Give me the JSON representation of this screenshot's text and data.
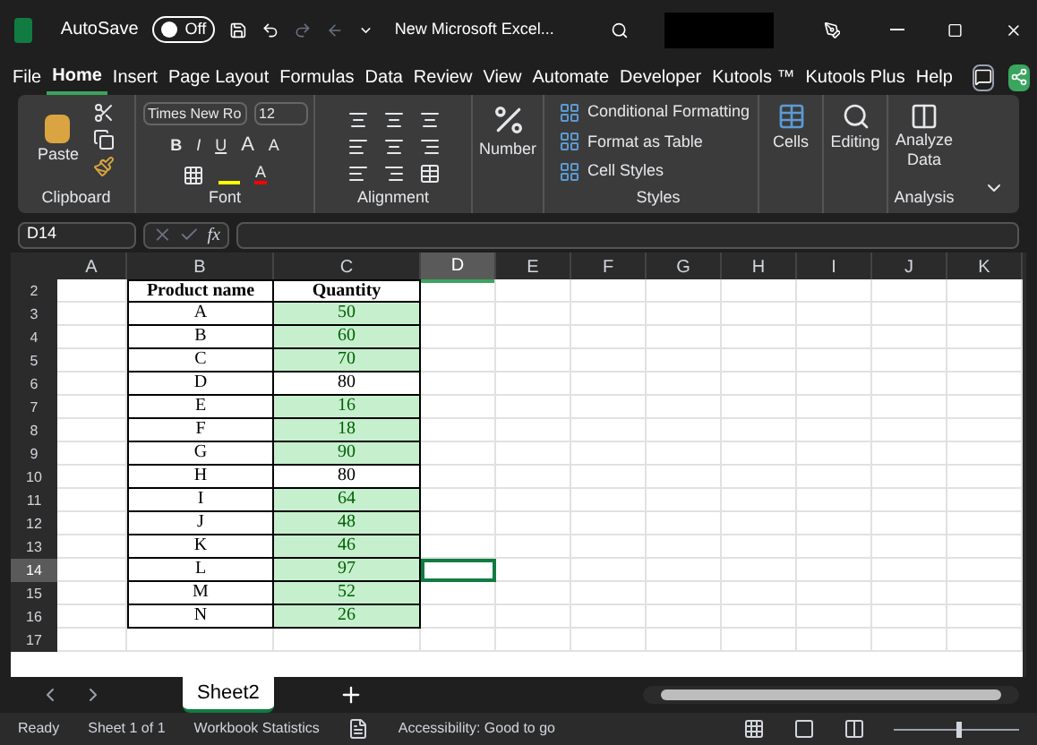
{
  "title_bar": {
    "autosave_label": "AutoSave",
    "autosave_state": "Off",
    "autosave_on": false,
    "file_name": "New Microsoft Excel..."
  },
  "menu_tabs": [
    {
      "label": "File",
      "selected": false
    },
    {
      "label": "Home",
      "selected": true
    },
    {
      "label": "Insert",
      "selected": false
    },
    {
      "label": "Page Layout",
      "selected": false
    },
    {
      "label": "Formulas",
      "selected": false
    },
    {
      "label": "Data",
      "selected": false
    },
    {
      "label": "Review",
      "selected": false
    },
    {
      "label": "View",
      "selected": false
    },
    {
      "label": "Automate",
      "selected": false
    },
    {
      "label": "Developer",
      "selected": false
    },
    {
      "label": "Kutools ™",
      "selected": false
    },
    {
      "label": "Kutools Plus",
      "selected": false
    },
    {
      "label": "Help",
      "selected": false
    }
  ],
  "ribbon": {
    "clipboard": {
      "label": "Clipboard",
      "paste": "Paste"
    },
    "font": {
      "label": "Font",
      "font_name": "Times New Ro",
      "font_size": "12",
      "bold": "B",
      "italic": "I",
      "underline": "U",
      "grow": "A",
      "shrink": "A",
      "font_color_button": "A"
    },
    "alignment": {
      "label": "Alignment"
    },
    "number": {
      "label": "Number"
    },
    "styles": {
      "label": "Styles",
      "items": [
        "Conditional Formatting",
        "Format as Table",
        "Cell Styles"
      ]
    },
    "cells": {
      "label": "Cells"
    },
    "editing": {
      "label": "Editing"
    },
    "analysis": {
      "label": "Analysis",
      "button": "Analyze Data"
    }
  },
  "formula_bar": {
    "name_box": "D14",
    "fx": "fx"
  },
  "grid": {
    "columns": [
      {
        "label": "A",
        "selected": false
      },
      {
        "label": "B",
        "selected": false
      },
      {
        "label": "C",
        "selected": false
      },
      {
        "label": "D",
        "selected": true
      },
      {
        "label": "E",
        "selected": false
      },
      {
        "label": "F",
        "selected": false
      },
      {
        "label": "G",
        "selected": false
      },
      {
        "label": "H",
        "selected": false
      },
      {
        "label": "I",
        "selected": false
      },
      {
        "label": "J",
        "selected": false
      },
      {
        "label": "K",
        "selected": false
      }
    ],
    "header_row": {
      "number": "2",
      "product": "Product name",
      "quantity": "Quantity"
    },
    "rows": [
      {
        "number": "3",
        "product": "A",
        "quantity": "50",
        "highlighted": true,
        "selected": false
      },
      {
        "number": "4",
        "product": "B",
        "quantity": "60",
        "highlighted": true,
        "selected": false
      },
      {
        "number": "5",
        "product": "C",
        "quantity": "70",
        "highlighted": true,
        "selected": false
      },
      {
        "number": "6",
        "product": "D",
        "quantity": "80",
        "highlighted": false,
        "selected": false
      },
      {
        "number": "7",
        "product": "E",
        "quantity": "16",
        "highlighted": true,
        "selected": false
      },
      {
        "number": "8",
        "product": "F",
        "quantity": "18",
        "highlighted": true,
        "selected": false
      },
      {
        "number": "9",
        "product": "G",
        "quantity": "90",
        "highlighted": true,
        "selected": false
      },
      {
        "number": "10",
        "product": "H",
        "quantity": "80",
        "highlighted": false,
        "selected": false
      },
      {
        "number": "11",
        "product": "I",
        "quantity": "64",
        "highlighted": true,
        "selected": false
      },
      {
        "number": "12",
        "product": "J",
        "quantity": "48",
        "highlighted": true,
        "selected": false
      },
      {
        "number": "13",
        "product": "K",
        "quantity": "46",
        "highlighted": true,
        "selected": false
      },
      {
        "number": "14",
        "product": "L",
        "quantity": "97",
        "highlighted": true,
        "selected": true
      },
      {
        "number": "15",
        "product": "M",
        "quantity": "52",
        "highlighted": true,
        "selected": false
      },
      {
        "number": "16",
        "product": "N",
        "quantity": "26",
        "highlighted": true,
        "selected": false
      }
    ],
    "empty_rows": [
      "17"
    ]
  },
  "sheet_tabs": [
    {
      "label": "Sheet2",
      "selected": true
    }
  ],
  "status_bar": {
    "items": [
      "Ready",
      "Sheet 1 of 1",
      "Workbook Statistics"
    ],
    "accessibility": "Accessibility: Good to go",
    "zoom_slider": {
      "level": 0.5
    }
  }
}
